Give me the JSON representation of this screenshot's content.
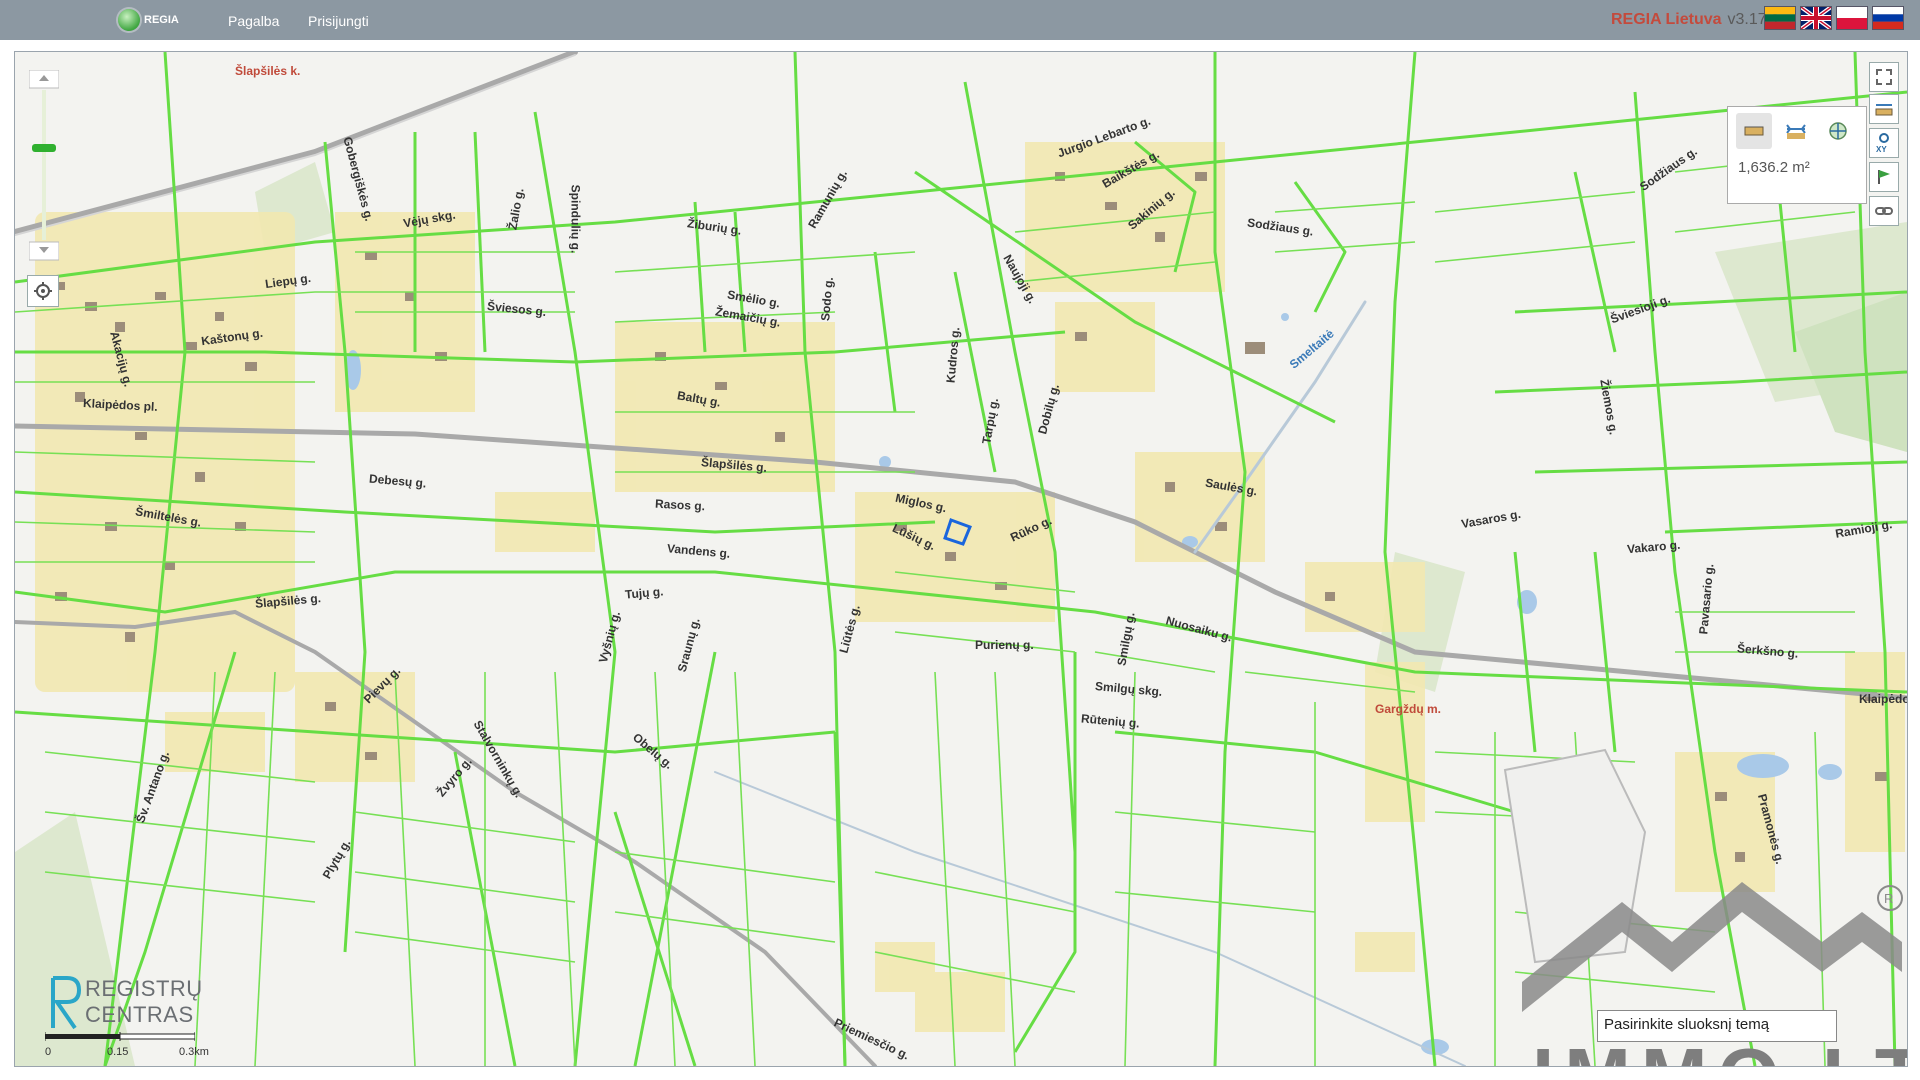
{
  "header": {
    "logo_text": "REGIA",
    "nav": [
      "Pagalba",
      "Prisijungti"
    ],
    "brand": "REGIA Lietuva",
    "version": "v3.17.1",
    "languages": [
      "lt-flag-icon",
      "en-flag-icon",
      "pl-flag-icon",
      "ru-flag-icon"
    ]
  },
  "map": {
    "measure": {
      "value": "1,636.2 m²",
      "tools": [
        "area-measure-icon",
        "distance-measure-icon",
        "coordinate-icon"
      ]
    },
    "right_tools": [
      "fullscreen-icon",
      "measure-tool-icon",
      "xy-icon",
      "flag-icon",
      "link-icon"
    ],
    "locate_icon": "locate-icon",
    "layer_input": {
      "placeholder": "Pasirinkite sluoksnį temą",
      "value": "Pasirinkite sluoksnį temą"
    },
    "scale": {
      "labels": [
        "0",
        "0.15",
        "0.3km"
      ]
    },
    "watermark": {
      "registrai": [
        "REGISTRŲ",
        "CENTRAS"
      ],
      "immo": "IMMO.LT"
    },
    "street_labels": [
      "Šlapšilės k.",
      "Gobergiškės g.",
      "Vėjų skg.",
      "Žalio g.",
      "Spindulių g.",
      "Žiburių g.",
      "Ramunių g.",
      "Jurgio Lebarto g.",
      "Baikštės g.",
      "Sakinių g.",
      "Sodžiaus g.",
      "Sodžiaus g.",
      "Liepų g.",
      "Šviesos g.",
      "Smėlio g.",
      "Žemaičių g.",
      "Šviesioji g.",
      "Kaštonų g.",
      "Akacijų g.",
      "Klaipėdos pl.",
      "Baltų g.",
      "Šlapšilės g.",
      "Smeltaitė",
      "Saulės g.",
      "Debesų g.",
      "Rasos g.",
      "Miglos g.",
      "Rūko g.",
      "Lūšių g.",
      "Vandens g.",
      "Vasaros g.",
      "Ramioji g.",
      "Vakaro g.",
      "Šmiltelės g.",
      "Šlapšilės g.",
      "Tujų g.",
      "Purienų g.",
      "Nuosaiku g.",
      "Šerkšno g.",
      "Klaipėdos",
      "Gargždų m.",
      "Rūtenių g.",
      "Smilgų skg.",
      "Obelų g.",
      "Stalvorninkų g.",
      "Pramonės g.",
      "Pievų g.",
      "Šv. Antano g.",
      "Dobilų g.",
      "Liūtės g.",
      "Naujoji g.",
      "Sodo g.",
      "Kudros g.",
      "Tarpų g.",
      "Plytų g.",
      "Priemiesčio g.",
      "Žvyro g.",
      "Vyšnių g.",
      "Sraunų g.",
      "Žiemos g.",
      "Smilgų g.",
      "Pavasario g."
    ],
    "district_label": "Gargždų m.",
    "colors": {
      "parcel": "#66dd44",
      "road": "#a9a9a9",
      "selected": "#1a66dd",
      "building": "#9c8d7a",
      "yard": "#f2e8b0"
    }
  }
}
